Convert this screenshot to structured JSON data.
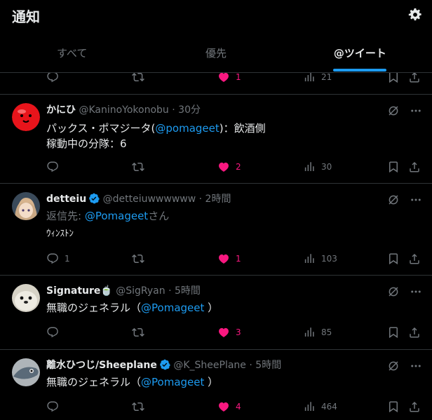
{
  "header": {
    "title": "通知"
  },
  "tabs": [
    {
      "label": "すべて"
    },
    {
      "label": "優先"
    },
    {
      "label": "@ツイート"
    }
  ],
  "colors": {
    "accent": "#1d9bf0",
    "like": "#f91880",
    "muted": "#71767b",
    "text": "#e7e9ea"
  },
  "partial": {
    "likes": "1",
    "views": "21"
  },
  "tweets": [
    {
      "name": "かにひ",
      "handle": "@KaninoYokonobu",
      "time": "30分",
      "text_pre": "パックス・ポマジータ(",
      "mention": "@pomageet",
      "text_post": ")：飲酒側",
      "line2": "稼動中の分隊：6",
      "replies": "",
      "retweets": "",
      "likes": "2",
      "views": "30"
    },
    {
      "name": "detteiu",
      "handle": "@detteiuwwwwww",
      "time": "2時間",
      "reply_label": "返信先: ",
      "reply_to": "@Pomageet",
      "reply_suffix": "さん",
      "text": "ｳｨﾝｽﾄﾝ",
      "replies": "1",
      "retweets": "",
      "likes": "1",
      "views": "103"
    },
    {
      "name": "Signature🍵",
      "handle": "@SigRyan",
      "time": "5時間",
      "text_pre": "無職のジェネラル（",
      "mention": "@Pomageet",
      "text_post": " ）",
      "replies": "",
      "retweets": "",
      "likes": "3",
      "views": "85"
    },
    {
      "name": "離水ひつじ/Sheeplane",
      "handle": "@K_SheePlane",
      "time": "5時間",
      "text_pre": "無職のジェネラル（",
      "mention": "@Pomageet",
      "text_post": " ）",
      "replies": "",
      "retweets": "",
      "likes": "4",
      "views": "464"
    }
  ],
  "sep": " · "
}
